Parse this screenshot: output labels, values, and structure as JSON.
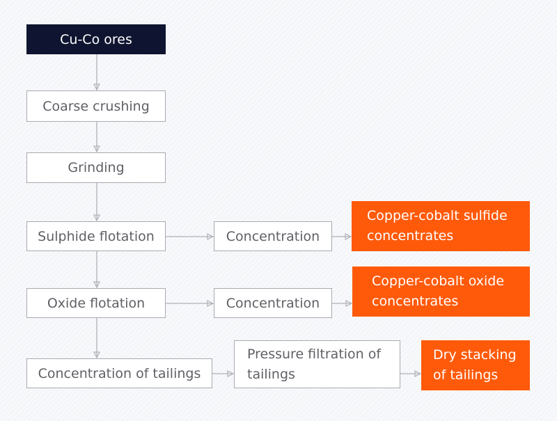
{
  "colors": {
    "start": "#0f1530",
    "product": "#ff5a0a",
    "connector": "#b0b1b8"
  },
  "nodes": {
    "ores": "Cu-Co ores",
    "coarse": "Coarse crushing",
    "grinding": "Grinding",
    "sulphide": "Sulphide flotation",
    "conc1": "Concentration",
    "sulfide_product_1": "Copper-cobalt sulfide",
    "sulfide_product_2": "concentrates",
    "oxide": "Oxide flotation",
    "conc2": "Concentration",
    "oxide_product_1": "Copper-cobalt oxide",
    "oxide_product_2": "concentrates",
    "tailings": "Concentration of tailings",
    "pressure_1": "Pressure filtration of",
    "pressure_2": "tailings",
    "dry_1": "Dry stacking",
    "dry_2": "of tailings"
  }
}
